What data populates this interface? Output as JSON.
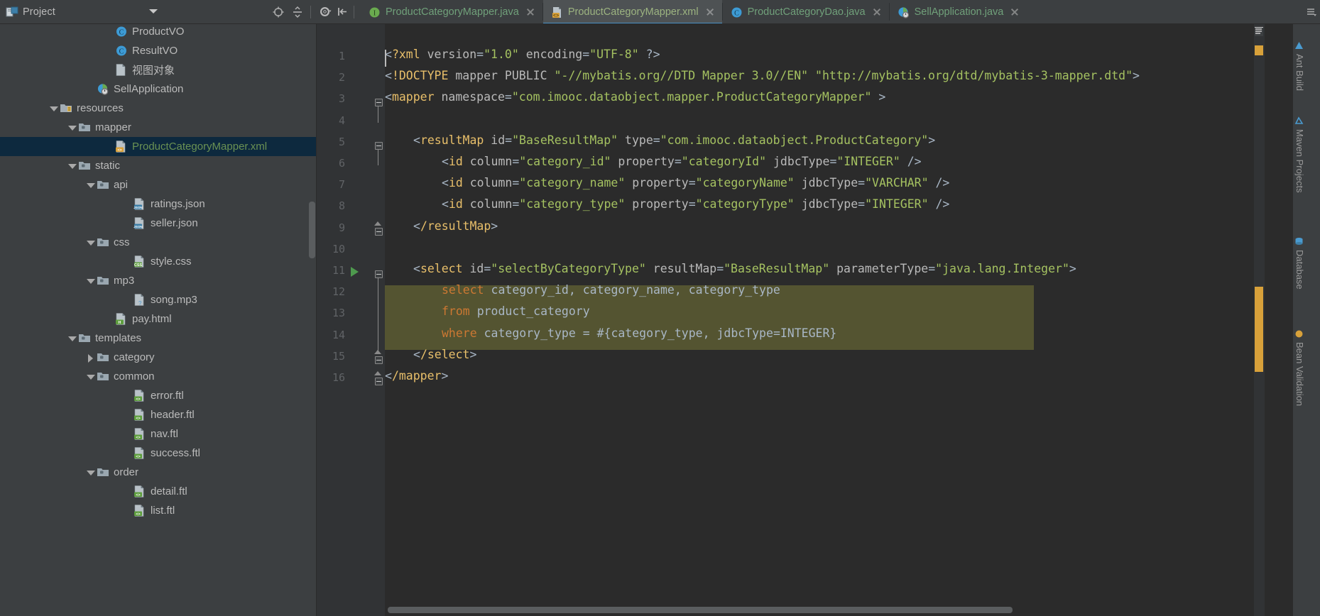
{
  "window": {
    "theme_bg": "#3c3f41",
    "editor_bg": "#2b2b2b",
    "accent": "#4a90c4"
  },
  "project_panel": {
    "title": "Project",
    "icons": {
      "panel": "project-panel-icon",
      "chevron": "chevron-down-icon",
      "locate": "locate-target-icon",
      "collapse": "collapse-all-icon"
    },
    "tree": [
      {
        "label": "ProductVO",
        "indent": 5,
        "twisty": "none",
        "icon": "class",
        "badge": "C"
      },
      {
        "label": "ResultVO",
        "indent": 5,
        "twisty": "none",
        "icon": "class",
        "badge": "C"
      },
      {
        "label": "视图对象",
        "indent": 5,
        "twisty": "none",
        "icon": "sheet",
        "badge": ""
      },
      {
        "label": "SellApplication",
        "indent": 4,
        "twisty": "none",
        "icon": "spring",
        "badge": ""
      },
      {
        "label": "resources",
        "indent": 2,
        "twisty": "down",
        "icon": "folder-res",
        "badge": ""
      },
      {
        "label": "mapper",
        "indent": 3,
        "twisty": "down",
        "icon": "folder",
        "badge": ""
      },
      {
        "label": "ProductCategoryMapper.xml",
        "indent": 5,
        "twisty": "none",
        "icon": "sheet",
        "badge": "xml",
        "selected": true
      },
      {
        "label": "static",
        "indent": 3,
        "twisty": "down",
        "icon": "folder",
        "badge": ""
      },
      {
        "label": "api",
        "indent": 4,
        "twisty": "down",
        "icon": "folder",
        "badge": ""
      },
      {
        "label": "ratings.json",
        "indent": 6,
        "twisty": "none",
        "icon": "sheet",
        "badge": "json"
      },
      {
        "label": "seller.json",
        "indent": 6,
        "twisty": "none",
        "icon": "sheet",
        "badge": "json"
      },
      {
        "label": "css",
        "indent": 4,
        "twisty": "down",
        "icon": "folder",
        "badge": ""
      },
      {
        "label": "style.css",
        "indent": 6,
        "twisty": "none",
        "icon": "sheet",
        "badge": "css"
      },
      {
        "label": "mp3",
        "indent": 4,
        "twisty": "down",
        "icon": "folder",
        "badge": ""
      },
      {
        "label": "song.mp3",
        "indent": 6,
        "twisty": "none",
        "icon": "sheet",
        "badge": "mp3"
      },
      {
        "label": "pay.html",
        "indent": 5,
        "twisty": "none",
        "icon": "sheet",
        "badge": "html"
      },
      {
        "label": "templates",
        "indent": 3,
        "twisty": "down",
        "icon": "folder",
        "badge": ""
      },
      {
        "label": "category",
        "indent": 4,
        "twisty": "right",
        "icon": "folder",
        "badge": ""
      },
      {
        "label": "common",
        "indent": 4,
        "twisty": "down",
        "icon": "folder",
        "badge": ""
      },
      {
        "label": "error.ftl",
        "indent": 6,
        "twisty": "none",
        "icon": "sheet",
        "badge": "ftl"
      },
      {
        "label": "header.ftl",
        "indent": 6,
        "twisty": "none",
        "icon": "sheet",
        "badge": "ftl"
      },
      {
        "label": "nav.ftl",
        "indent": 6,
        "twisty": "none",
        "icon": "sheet",
        "badge": "ftl"
      },
      {
        "label": "success.ftl",
        "indent": 6,
        "twisty": "none",
        "icon": "sheet",
        "badge": "ftl"
      },
      {
        "label": "order",
        "indent": 4,
        "twisty": "down",
        "icon": "folder",
        "badge": ""
      },
      {
        "label": "detail.ftl",
        "indent": 6,
        "twisty": "none",
        "icon": "sheet",
        "badge": "ftl"
      },
      {
        "label": "list.ftl",
        "indent": 6,
        "twisty": "none",
        "icon": "sheet",
        "badge": "ftl"
      }
    ]
  },
  "editor_tabs": {
    "toolbar_icons": [
      "settings-gear-icon",
      "hide-panel-icon"
    ],
    "right_icons": [
      "more-tabs-icon",
      "hide-tabs-icon"
    ],
    "items": [
      {
        "label": "ProductCategoryMapper.java",
        "icon": "interface-icon",
        "active": false,
        "closeable": true
      },
      {
        "label": "ProductCategoryMapper.xml",
        "icon": "xml-file-icon",
        "active": true,
        "closeable": true
      },
      {
        "label": "ProductCategoryDao.java",
        "icon": "class-icon",
        "active": false,
        "closeable": true
      },
      {
        "label": "SellApplication.java",
        "icon": "spring-icon",
        "active": false,
        "closeable": false
      }
    ]
  },
  "code": {
    "line_numbers": [
      "1",
      "2",
      "3",
      "4",
      "5",
      "6",
      "7",
      "8",
      "9",
      "10",
      "11",
      "12",
      "13",
      "14",
      "15",
      "16"
    ],
    "lines": [
      {
        "n": 1,
        "indent": 0,
        "text": "<?xml version=\"1.0\" encoding=\"UTF-8\" ?>"
      },
      {
        "n": 2,
        "indent": 0,
        "text": "<!DOCTYPE mapper PUBLIC \"-//mybatis.org//DTD Mapper 3.0//EN\" \"http://mybatis.org/dtd/mybatis-3-mapper.dtd\">"
      },
      {
        "n": 3,
        "indent": 0,
        "text": "<mapper namespace=\"com.imooc.dataobject.mapper.ProductCategoryMapper\" >"
      },
      {
        "n": 4,
        "indent": 0,
        "text": ""
      },
      {
        "n": 5,
        "indent": 1,
        "text": "<resultMap id=\"BaseResultMap\" type=\"com.imooc.dataobject.ProductCategory\">"
      },
      {
        "n": 6,
        "indent": 2,
        "text": "<id column=\"category_id\" property=\"categoryId\" jdbcType=\"INTEGER\" />"
      },
      {
        "n": 7,
        "indent": 2,
        "text": "<id column=\"category_name\" property=\"categoryName\" jdbcType=\"VARCHAR\" />"
      },
      {
        "n": 8,
        "indent": 2,
        "text": "<id column=\"category_type\" property=\"categoryType\" jdbcType=\"INTEGER\" />"
      },
      {
        "n": 9,
        "indent": 1,
        "text": "</resultMap>"
      },
      {
        "n": 10,
        "indent": 0,
        "text": ""
      },
      {
        "n": 11,
        "indent": 1,
        "text": "<select id=\"selectByCategoryType\" resultMap=\"BaseResultMap\" parameterType=\"java.lang.Integer\">"
      },
      {
        "n": 12,
        "indent": 2,
        "text": "select category_id, category_name, category_type"
      },
      {
        "n": 13,
        "indent": 2,
        "text": "from product_category"
      },
      {
        "n": 14,
        "indent": 2,
        "text": "where category_type = #{category_type, jdbcType=INTEGER}"
      },
      {
        "n": 15,
        "indent": 1,
        "text": "</select>"
      },
      {
        "n": 16,
        "indent": 0,
        "text": "</mapper>"
      }
    ],
    "sql_highlight_lines": [
      12,
      13,
      14
    ],
    "gutter_run_marker_line": 11,
    "caret_line": 1
  },
  "right_toolbar": {
    "tabs": [
      {
        "label": "Ant Build",
        "icon": "ant-icon"
      },
      {
        "label": "Maven Projects",
        "icon": "maven-icon"
      },
      {
        "label": "Database",
        "icon": "database-icon"
      },
      {
        "label": "Bean Validation",
        "icon": "bean-icon"
      }
    ]
  }
}
